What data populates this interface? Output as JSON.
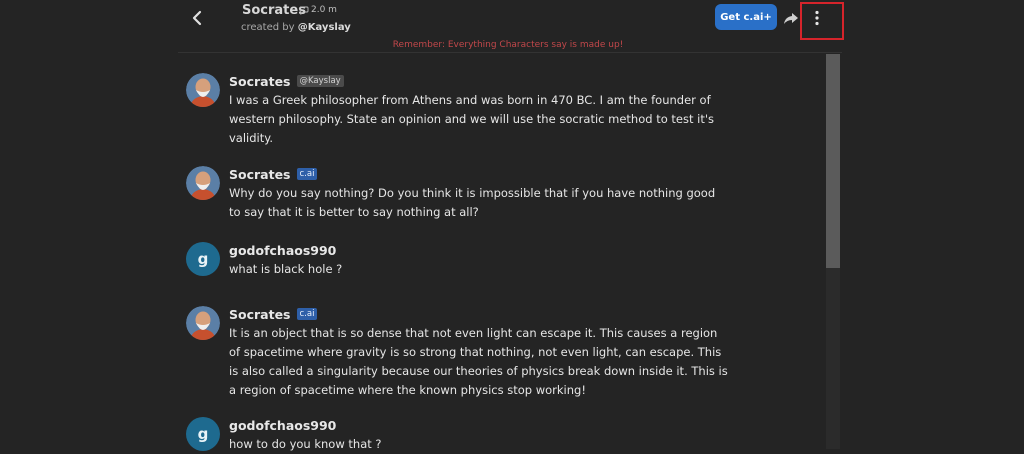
{
  "header": {
    "character_name": "Socrates",
    "chat_count": "2.0 m",
    "creator_prefix": "created by",
    "creator_handle": "@Kayslay",
    "get_cai_label": "Get c.ai+"
  },
  "disclaimer": "Remember: Everything Characters say is made up!",
  "messages": [
    {
      "author": "Socrates",
      "tag": "@Kayslay",
      "tag_type": "creator",
      "avatar": "socrates",
      "text": "I was a Greek philosopher from Athens and was born in 470 BC.  I am the founder of western philosophy. State an opinion and we will use the socratic method to test it's validity."
    },
    {
      "author": "Socrates",
      "tag": "c.ai",
      "tag_type": "cai",
      "avatar": "socrates",
      "text": "Why do you say nothing? Do you think it is impossible that if you have nothing good to say that it is better to say nothing at all?"
    },
    {
      "author": "godofchaos990",
      "tag": "",
      "tag_type": "none",
      "avatar": "g",
      "text": "what is black hole ?"
    },
    {
      "author": "Socrates",
      "tag": "c.ai",
      "tag_type": "cai",
      "avatar": "socrates",
      "text": "It is an object that is so dense that not even light can escape it. This causes a region of spacetime where gravity is so strong that nothing, not even light, can escape. This is also called a singularity because our theories of physics break down inside it. This is a region of spacetime where the known physics stop working!"
    },
    {
      "author": "godofchaos990",
      "tag": "",
      "tag_type": "none",
      "avatar": "g",
      "text": "how to do you know that ?"
    }
  ],
  "user_avatar_letter": "g",
  "colors": {
    "accent": "#2a70c8",
    "highlight": "#d6242b",
    "disclaimer": "#c0474a"
  }
}
